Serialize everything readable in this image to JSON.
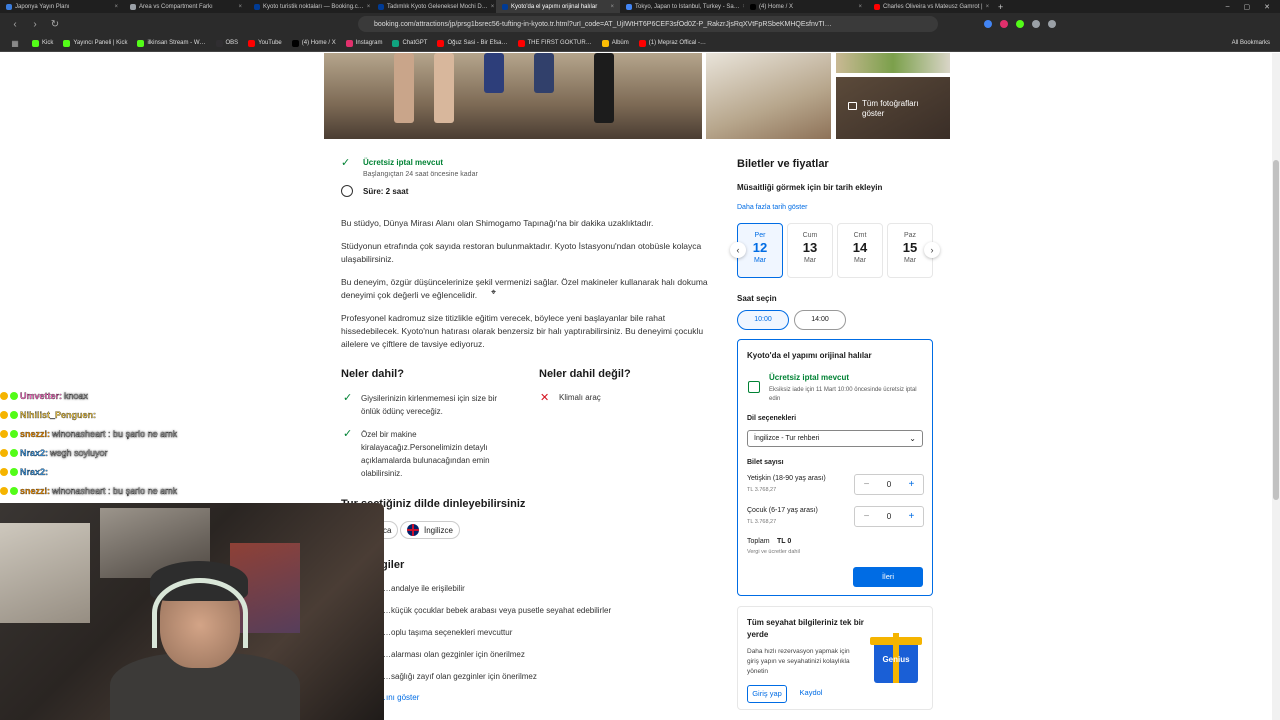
{
  "browser": {
    "tabs": [
      {
        "label": "Japonya Yayın Planı",
        "color": "#3b7ddd"
      },
      {
        "label": "Area vs Compartment Farkı",
        "color": "#9aa0a6"
      },
      {
        "label": "Kyoto turistik noktaları — Booking.c…",
        "color": "#003b95"
      },
      {
        "label": "Tadımlık Kyoto Geleneksel Mochi D…",
        "color": "#003b95"
      },
      {
        "label": "Kyoto'da el yapımı orijinal halılar",
        "color": "#003b95"
      },
      {
        "label": "Tokyo, Japan to Istanbul, Turkey - Sa…",
        "color": "#4285f4"
      },
      {
        "label": "(4) Home / X",
        "color": "#000000"
      },
      {
        "label": "Charles Oliveira vs Mateusz Gamrot |",
        "color": "#ff0000"
      }
    ],
    "new_tab": "+",
    "url": "booking.com/attractions/jp/prsg1bsrec56-tufting-in-kyoto.tr.html?urI_code=AT_UjIWtHT6P6CEF3sfOd0Z-P_RakzrJjsRqXVtFpRSbeKMHQEsfnvTI…",
    "bookmarks": [
      {
        "label": "Kick",
        "color": "#53fc18"
      },
      {
        "label": "Yayıncı Paneli | Kick",
        "color": "#53fc18"
      },
      {
        "label": "ilkinsan Stream - W…",
        "color": "#53fc18"
      },
      {
        "label": "OBS",
        "color": "#302e31"
      },
      {
        "label": "YouTube",
        "color": "#ff0000"
      },
      {
        "label": "(4) Home / X",
        "color": "#000000"
      },
      {
        "label": "Instagram",
        "color": "#e1306c"
      },
      {
        "label": "ChatGPT",
        "color": "#10a37f"
      },
      {
        "label": "Oğuz Sasi - Bir Efsa…",
        "color": "#ff0000"
      },
      {
        "label": "THE FIRST GOKTUR…",
        "color": "#ff0000"
      },
      {
        "label": "Albüm",
        "color": "#fbbc04"
      },
      {
        "label": "(1) Mepraz Offical -…",
        "color": "#ff0000"
      }
    ],
    "all_bookmarks": "All Bookmarks"
  },
  "gallery": {
    "show_all": "Tüm fotoğrafları göster"
  },
  "left": {
    "cancel_title": "Ücretsiz iptal mevcut",
    "cancel_sub": "Başlangıçtan 24 saat öncesine kadar",
    "duration": "Süre: 2 saat",
    "paragraphs": [
      "Bu stüdyo, Dünya Mirası Alanı olan Shimogamo Tapınağı'na bir dakika uzaklıktadır.",
      "Stüdyonun etrafında çok sayıda restoran bulunmaktadır. Kyoto İstasyonu'ndan otobüsle kolayca ulaşabilirsiniz.",
      "Bu deneyim, özgür düşüncelerinize şekil vermenizi sağlar. Özel makineler kullanarak halı dokuma deneyimi çok değerli ve eğlencelidir.",
      "Profesyonel kadromuz size titizlikle eğitim verecek, böylece yeni başlayanlar bile rahat hissedebilecek. Kyoto'nun hatırası olarak benzersiz bir halı yaptırabilirsiniz. Bu deneyimi çocuklu ailelere ve çiftlere de tavsiye ediyoruz."
    ],
    "included_title": "Neler dahil?",
    "included": [
      "Giysilerinizin kirlenmemesi için size bir önlük ödünç vereceğiz.",
      "Özel bir makine kiralayacağız.Personelimizin detaylı açıklamalarda bulunacağından emin olabilirsiniz."
    ],
    "not_included_title": "Neler dahil değil?",
    "not_included": [
      "Klimalı araç"
    ],
    "lang_title": "Tur seçtiğiniz dilde dinleyebilirsiniz",
    "lang_pills": [
      "…ca",
      "İngilizce"
    ],
    "info_title": "…giler",
    "info_items": [
      "…andalye ile erişilebilir",
      "…küçük çocuklar bebek arabası veya pusetle seyahat edebilirler",
      "…oplu taşıma seçenekleri mevcuttur",
      "…alarması olan gezginler için önerilmez",
      "…sağlığı zayıf olan gezginler için önerilmez"
    ],
    "info_more": "…ını göster"
  },
  "right": {
    "title": "Biletler ve fiyatlar",
    "date_prompt": "Müsaitliği görmek için bir tarih ekleyin",
    "more_dates": "Daha fazla tarih göster",
    "dates": [
      {
        "day": "Per",
        "num": "12",
        "month": "Mar",
        "selected": true
      },
      {
        "day": "Cum",
        "num": "13",
        "month": "Mar",
        "selected": false
      },
      {
        "day": "Cmt",
        "num": "14",
        "month": "Mar",
        "selected": false
      },
      {
        "day": "Paz",
        "num": "15",
        "month": "Mar",
        "selected": false
      }
    ],
    "time_title": "Saat seçin",
    "times": [
      {
        "label": "10:00",
        "selected": true
      },
      {
        "label": "14:00",
        "selected": false
      }
    ],
    "box": {
      "title": "Kyoto'da el yapımı orijinal halılar",
      "cancel_title": "Ücretsiz iptal mevcut",
      "cancel_sub": "Eksiksiz iade için 11 Mart 10:00 öncesinde ücretsiz iptal edin",
      "lang_label": "Dil seçenekleri",
      "lang_value": "İngilizce - Tur rehberi",
      "ticket_label": "Bilet sayısı",
      "adult_label": "Yetişkin (18-90 yaş arası)",
      "adult_price": "TL 3.768,27",
      "adult_qty": "0",
      "child_label": "Çocuk (6-17 yaş arası)",
      "child_price": "TL 3.768,27",
      "child_qty": "0",
      "total_label": "Toplam",
      "total_value": "TL 0",
      "total_sub": "Vergi ve ücretler dahil",
      "next": "İleri"
    },
    "genius": {
      "title": "Tüm seyahat bilgileriniz tek bir yerde",
      "body": "Daha hızlı rezervasyon yapmak için giriş yapın ve seyahatinizi kolaylıkla yönetin",
      "login": "Giriş yap",
      "register": "Kaydol",
      "badge": "Genius"
    }
  },
  "chat": [
    {
      "name": "Umvetter:",
      "msg": "knoax",
      "color": "#ff6ec7"
    },
    {
      "name": "Nihilist_Penguen:",
      "msg": "",
      "color": "#ffd54f"
    },
    {
      "name": "snezzi:",
      "msg": "winonasheart : bu şarlo ne amk",
      "color": "#ff9800"
    },
    {
      "name": "Nrax2:",
      "msg": "wegh soyluyor",
      "color": "#42a5f5"
    },
    {
      "name": "Nrax2:",
      "msg": "",
      "color": "#42a5f5"
    },
    {
      "name": "snezzi:",
      "msg": "winonasheart : bu şarlo ne amk",
      "color": "#ff9800"
    }
  ]
}
